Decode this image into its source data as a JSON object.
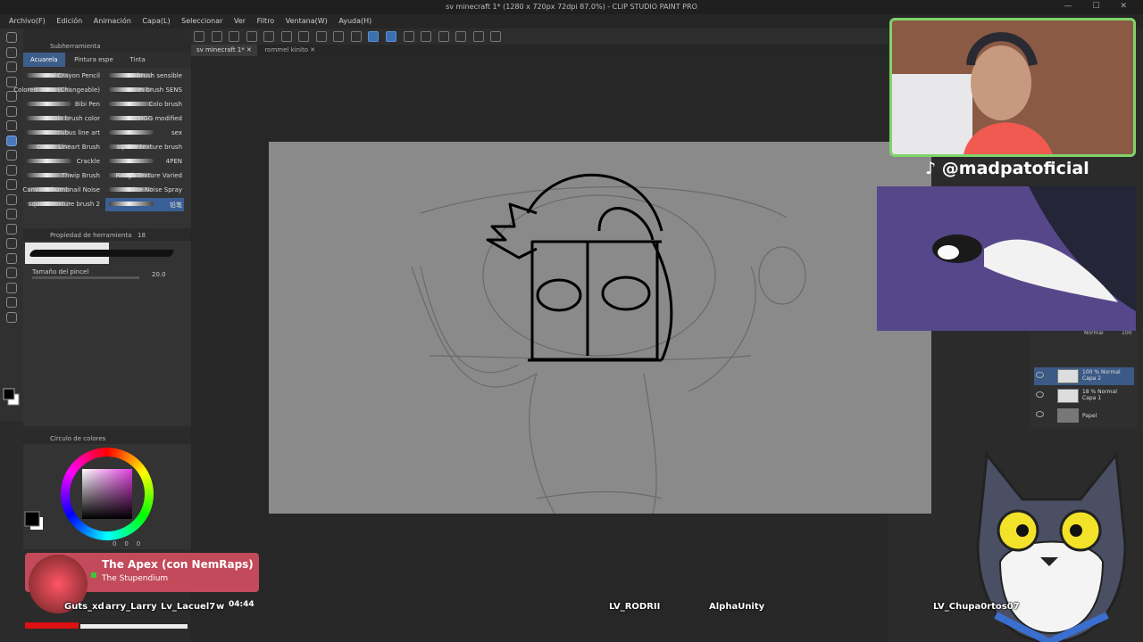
{
  "window": {
    "title": "sv minecraft 1* (1280 x 720px 72dpi 87.0%) - CLIP STUDIO PAINT PRO",
    "controls": "— ☐ ✕"
  },
  "menu": [
    "Archivo(F)",
    "Edición",
    "Animación",
    "Capa(L)",
    "Seleccionar",
    "Ver",
    "Filtro",
    "Ventana(W)",
    "Ayuda(H)"
  ],
  "doc_tabs": [
    "sv minecraft 1*",
    "rommel kinito"
  ],
  "subtool_panel": {
    "title": "Subherramienta",
    "tabs": [
      "Acuarela",
      "Pintura espe",
      "Tinta"
    ],
    "brushes": [
      [
        "Sai Crayon Pencil",
        "m brush sensible"
      ],
      [
        "Colored Trees (Changeable)",
        "m brush SENS"
      ],
      [
        "Bibi Pen",
        "Colo brush"
      ],
      [
        "Colo brush color",
        "HIMGG modified"
      ],
      [
        "Succubus line art",
        "sex"
      ],
      [
        "Comic Lineart Brush",
        "square texture brush"
      ],
      [
        "Crackle",
        "4PEN"
      ],
      [
        "Thwip Brush",
        "Rough Texture Varied"
      ],
      [
        "Canvas Thumbnail Noise",
        "Line Noise Spray"
      ],
      [
        "square texture brush 2",
        "铅笔"
      ]
    ]
  },
  "tool_property": {
    "title": "Propiedad de herramienta",
    "tab_num": "18",
    "size_label": "Tamaño del pincel",
    "size_value": "20.0"
  },
  "color_panel": {
    "title": "Círculo de colores",
    "rgb": [
      "0",
      "0",
      "0"
    ]
  },
  "layers": [
    {
      "blend": "100 % Normal",
      "name": "Capa 2"
    },
    {
      "blend": "18 % Normal",
      "name": "Capa 1"
    },
    {
      "blend": "",
      "name": "Papel"
    }
  ],
  "layer_panel": {
    "mode": "Normal",
    "opacity": "100"
  },
  "stream": {
    "tiktok_handle": "@madpatoficial",
    "now_playing": {
      "title": "The Apex (con NemRaps)",
      "artist": "The Stupendium",
      "time": "04:44"
    },
    "viewers": [
      "Guts_xd",
      "arry_Larry",
      "Lv_Lacuel7",
      "w",
      "LV_RODRII",
      "AlphaUnity",
      "LV_Chupa0rtos07"
    ]
  },
  "colors": {
    "accent": "#3c6fae",
    "webcam_border": "#7fd36a",
    "now_playing_bg": "#c24a5a"
  }
}
